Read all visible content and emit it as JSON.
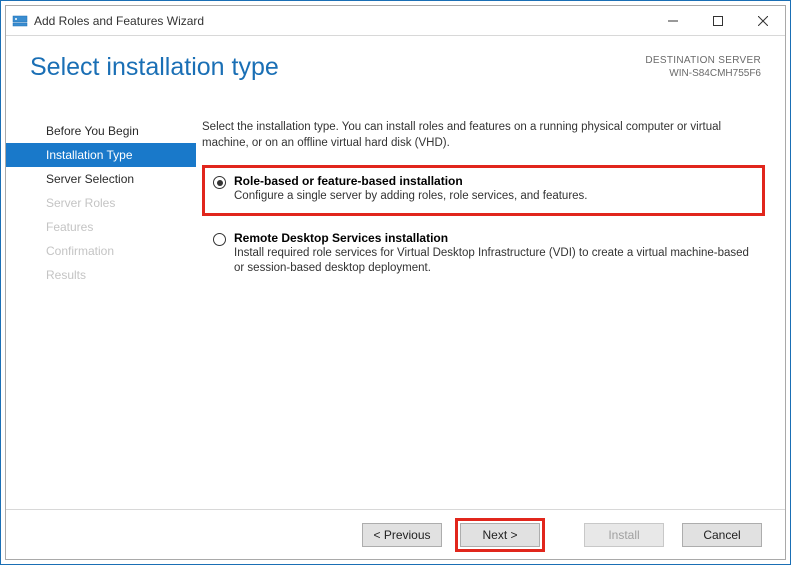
{
  "window": {
    "title": "Add Roles and Features Wizard"
  },
  "header": {
    "page_title": "Select installation type",
    "destination_label": "DESTINATION SERVER",
    "destination_value": "WIN-S84CMH755F6"
  },
  "sidebar": {
    "items": [
      {
        "label": "Before You Begin",
        "state": "normal"
      },
      {
        "label": "Installation Type",
        "state": "active"
      },
      {
        "label": "Server Selection",
        "state": "normal"
      },
      {
        "label": "Server Roles",
        "state": "disabled"
      },
      {
        "label": "Features",
        "state": "disabled"
      },
      {
        "label": "Confirmation",
        "state": "disabled"
      },
      {
        "label": "Results",
        "state": "disabled"
      }
    ]
  },
  "main": {
    "intro": "Select the installation type. You can install roles and features on a running physical computer or virtual machine, or on an offline virtual hard disk (VHD).",
    "options": [
      {
        "title": "Role-based or feature-based installation",
        "desc": "Configure a single server by adding roles, role services, and features.",
        "selected": true,
        "highlighted": true
      },
      {
        "title": "Remote Desktop Services installation",
        "desc": "Install required role services for Virtual Desktop Infrastructure (VDI) to create a virtual machine-based or session-based desktop deployment.",
        "selected": false,
        "highlighted": false
      }
    ]
  },
  "footer": {
    "previous": "< Previous",
    "next": "Next >",
    "install": "Install",
    "cancel": "Cancel",
    "next_highlighted": true,
    "install_enabled": false
  }
}
